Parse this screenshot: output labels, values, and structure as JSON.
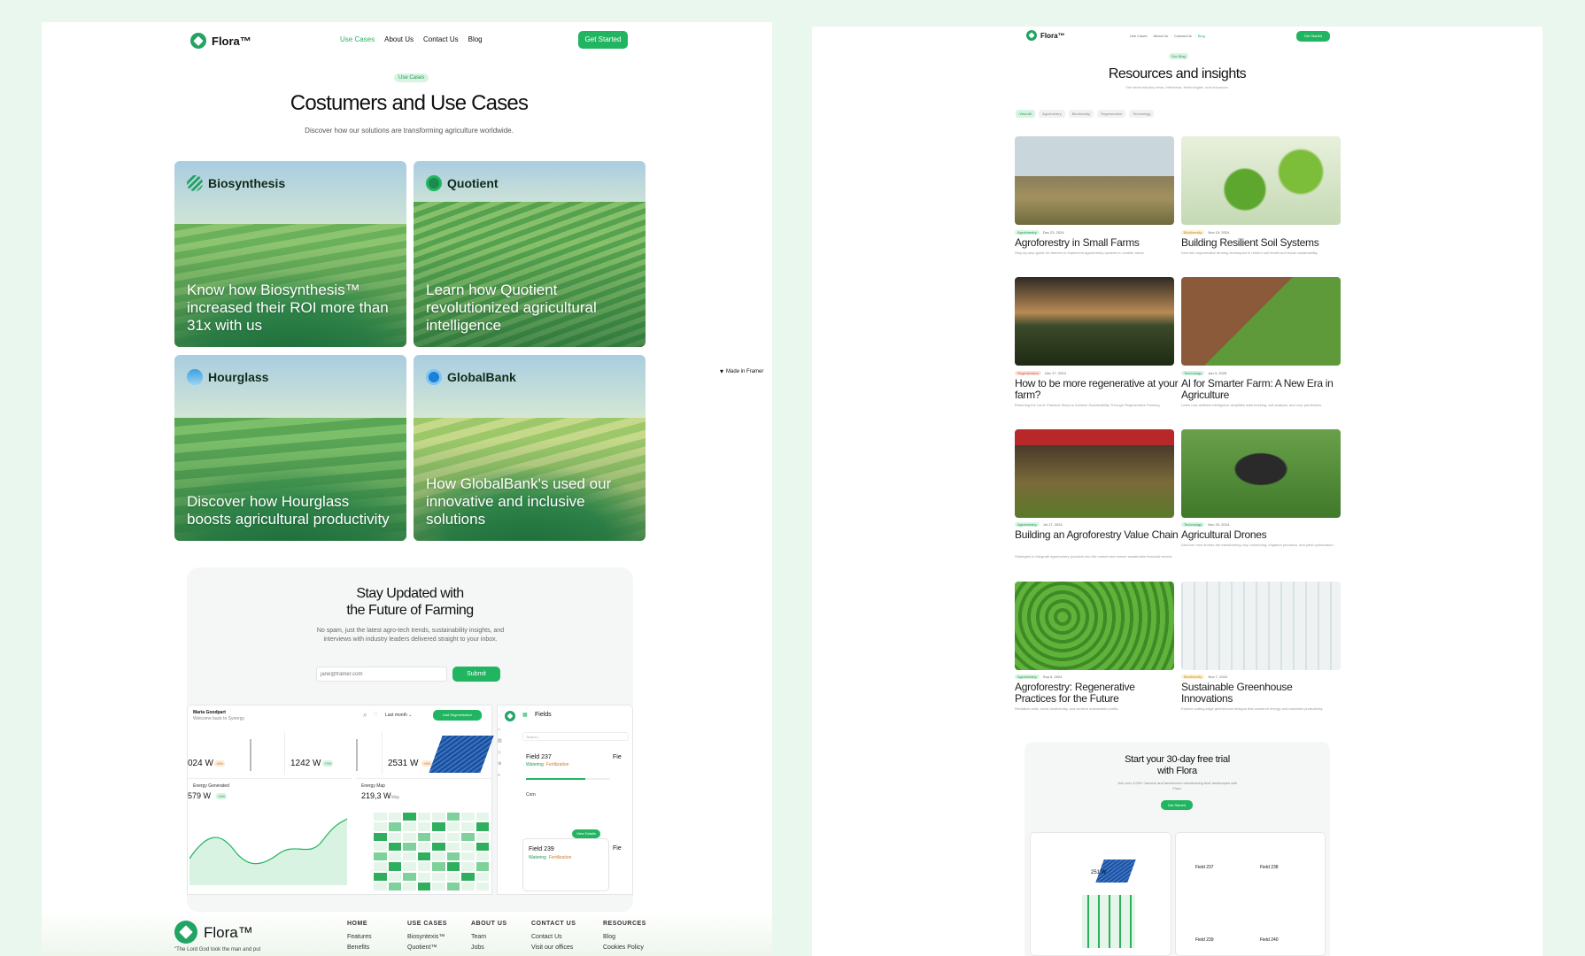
{
  "left_page": {
    "nav": {
      "brand": "Flora™",
      "links": [
        "Use Cases",
        "About Us",
        "Contact Us",
        "Blog"
      ],
      "cta": "Get Started"
    },
    "hero": {
      "tag": "Use Cases",
      "title": "Costumers and Use Cases",
      "subtitle": "Discover how our solutions are transforming agriculture worldwide."
    },
    "cards": [
      {
        "brand": "Biosynthesis",
        "text": "Know how Biosynthesis™ increased their ROI more than 31x with us"
      },
      {
        "brand": "Quotient",
        "text": "Learn how Quotient revolutionized agricultural intelligence"
      },
      {
        "brand": "Hourglass",
        "text": "Discover how Hourglass boosts agricultural productivity"
      },
      {
        "brand": "GlobalBank",
        "text": "How GlobalBank's used our innovative and inclusive solutions"
      }
    ],
    "newsletter": {
      "title_line1": "Stay Updated with",
      "title_line2": "the Future of Farming",
      "desc": "No spam, just the latest agro-tech trends, sustainability insights, and interviews with industry leaders delivered straight to your inbox.",
      "placeholder": "jane@framer.com",
      "button": "Submit"
    },
    "dashboard": {
      "user": "Maria Goodpart",
      "welcome": "Welcome back to Synergy",
      "period": "Last month",
      "add_button": "Add Segmentation",
      "metrics": [
        {
          "value": "024 W",
          "badge": "+8%"
        },
        {
          "value": "1242 W",
          "badge": "+7%"
        },
        {
          "value": "2531 W",
          "badge": "+9%"
        }
      ],
      "energy_label": "Energy Generated",
      "energy_value": "579 W",
      "energy_badge": "+4%",
      "map_label": "Energy Map",
      "map_value": "219,3 W",
      "map_unit": "/day",
      "fields_title": "Fields",
      "search_placeholder": "Search...",
      "field1": "Field 237",
      "field2": "Field 239",
      "field_tag1": "Watering",
      "field_tag2": "Fertilization",
      "crop": "Corn",
      "view_details": "View Details"
    },
    "made_in_framer": "Made in Framer",
    "footer": {
      "brand": "Flora™",
      "quote": "\"The Lord God took the man and put",
      "columns": [
        {
          "title": "HOME",
          "items": [
            "Features",
            "Benefits"
          ]
        },
        {
          "title": "USE CASES",
          "items": [
            "Biosyntexis™",
            "Quotient™"
          ]
        },
        {
          "title": "ABOUT US",
          "items": [
            "Team",
            "Jobs"
          ]
        },
        {
          "title": "CONTACT US",
          "items": [
            "Contact Us",
            "Visit our offices"
          ]
        },
        {
          "title": "RESOURCES",
          "items": [
            "Blog",
            "Cookies Policy"
          ]
        }
      ]
    }
  },
  "right_page": {
    "nav": {
      "brand": "Flora™",
      "links": [
        "Use Cases",
        "About Us",
        "Contact Us",
        "Blog"
      ],
      "cta": "Get Started"
    },
    "hero": {
      "tag": "Our Blog",
      "title": "Resources and insights",
      "subtitle": "The latest industry news, interviews, technologies, and resources."
    },
    "filters": [
      "View All",
      "Agroforestry",
      "Biodiversity",
      "Regeneration",
      "Technology"
    ],
    "posts": [
      {
        "tag": "Agroforestry",
        "date": "Dec 23, 2024",
        "title": "Agroforestry in Small Farms",
        "desc": "Step-by-step guide for farmers to implement agroforestry systems in smaller areas."
      },
      {
        "tag": "Biodiversity",
        "date": "Nov 15, 2024",
        "title": "Building Resilient Soil Systems",
        "desc": "Dive into regenerative farming techniques to restore soil health and boost sustainability."
      },
      {
        "tag": "Regeneration",
        "date": "Dec 27, 2024",
        "title": "How to be more regenerative at your farm?",
        "desc": "Restoring the Land: Practical Steps to Achieve Sustainability Through Regenerative Farming"
      },
      {
        "tag": "Technology",
        "date": "Jan 3, 2025",
        "title": "AI for Smarter Farm: A New Era in Agriculture",
        "desc": "Learn how artificial intelligence simplifies data tracking, soil analysis, and crop predictions."
      },
      {
        "tag": "Agroforestry",
        "date": "Jul 17, 2024",
        "title": "Building an Agroforestry Value Chain",
        "desc": "Strategies to integrate agroforestry products into the market and ensure sustainable financial returns."
      },
      {
        "tag": "Technology",
        "date": "Nov 20, 2024",
        "title": "Agricultural Drones",
        "desc": "Discover how drones are transforming crop monitoring, irrigation precision, and yield optimization."
      },
      {
        "tag": "Agroforestry",
        "date": "Sep 6, 2024",
        "title": "Agroforestry: Regenerative Practices for the Future",
        "desc": "Revitalize soils, boost biodiversity, and achieve sustainable profits."
      },
      {
        "tag": "Biodiversity",
        "date": "Nov 7, 2024",
        "title": "Sustainable Greenhouse Innovations",
        "desc": "Explore cutting-edge greenhouse designs that conserve energy and maximize productivity."
      }
    ],
    "trial": {
      "title_line1": "Start your 30-day free trial",
      "title_line2": "with Flora",
      "desc": "Join over 4,000+ farmers and landowners transforming their landscapes with Flora.",
      "button": "Get Started",
      "preview_value": "251 W",
      "preview_fields": [
        "Field 237",
        "Field 238",
        "Field 239",
        "Field 240"
      ]
    }
  },
  "colors": {
    "accent": "#22b561",
    "background": "#e9f7ee"
  }
}
